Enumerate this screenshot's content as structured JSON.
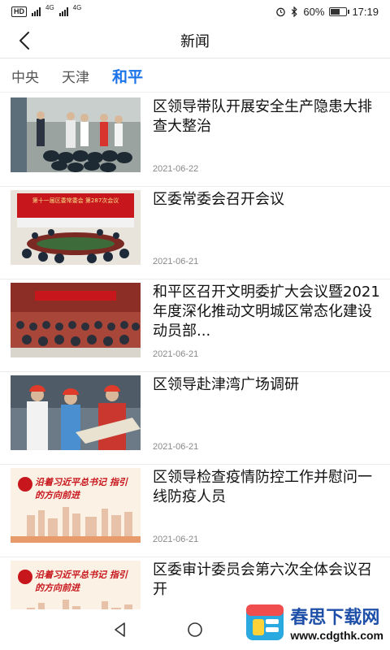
{
  "status_bar": {
    "left_indicators": [
      "HD",
      "4G",
      "4G"
    ],
    "battery": "60%",
    "battery_level": 0.6,
    "time": "17:19"
  },
  "header": {
    "title": "新闻"
  },
  "tabs": [
    {
      "label": "中央",
      "active": false
    },
    {
      "label": "天津",
      "active": false
    },
    {
      "label": "和平",
      "active": true
    }
  ],
  "news": [
    {
      "title": "区领导带队开展安全生产隐患大排查大整治",
      "date": "2021-06-22"
    },
    {
      "title": "区委常委会召开会议",
      "date": "2021-06-21",
      "banner_text": "第十一届区委常委会 第287次会议"
    },
    {
      "title": "和平区召开文明委扩大会议暨2021年度深化推动文明城区常态化建设动员部...",
      "date": "2021-06-21"
    },
    {
      "title": "区领导赴津湾广场调研",
      "date": "2021-06-21"
    },
    {
      "title": "区领导检查疫情防控工作并慰问一线防疫人员",
      "date": "2021-06-21",
      "banner_text": "沿着习近平总书记 指引的方向前进"
    },
    {
      "title": "区委审计委员会第六次全体会议召开",
      "date": "",
      "banner_text": "沿着习近平总书记 指引的方向前进"
    }
  ],
  "watermark": {
    "name": "春思下载网",
    "url": "www.cdgthk.com"
  },
  "colors": {
    "accent": "#1a73e8",
    "banner_red": "#c8161d"
  }
}
